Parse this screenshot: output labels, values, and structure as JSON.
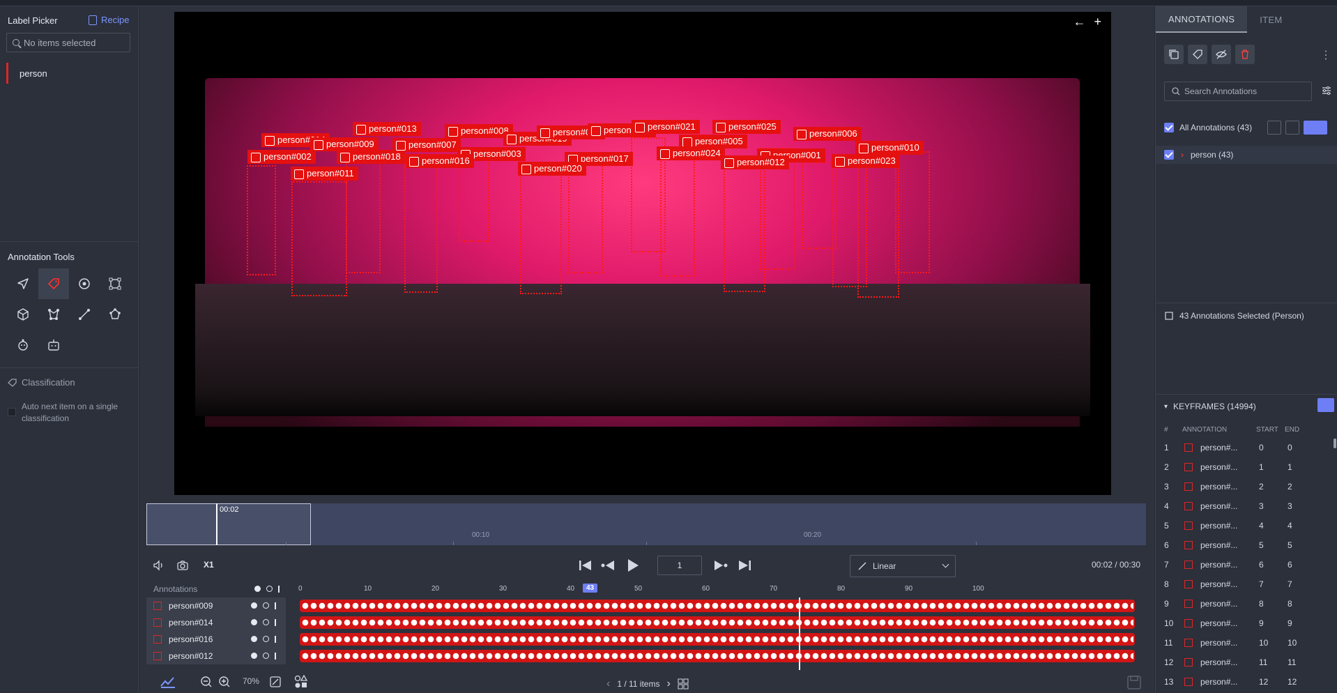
{
  "left_panel": {
    "title": "Label Picker",
    "recipe": "Recipe",
    "search_placeholder": "No items selected",
    "labels": [
      "person"
    ],
    "tools_title": "Annotation Tools",
    "classification": "Classification",
    "auto_next": "Auto next item on a single classification"
  },
  "video": {
    "annotations": [
      {
        "label": "person#014"
      },
      {
        "label": "person#009"
      },
      {
        "label": "person#013"
      },
      {
        "label": "person#008"
      },
      {
        "label": "person#019"
      },
      {
        "label": "person#022"
      },
      {
        "label": "person#004"
      },
      {
        "label": "person#021"
      },
      {
        "label": "person#025"
      },
      {
        "label": "person#006"
      },
      {
        "label": "person#002"
      },
      {
        "label": "person#018"
      },
      {
        "label": "person#007"
      },
      {
        "label": "person#003"
      },
      {
        "label": "person#016"
      },
      {
        "label": "person#017"
      },
      {
        "label": "person#005"
      },
      {
        "label": "person#024"
      },
      {
        "label": "person#001"
      },
      {
        "label": "person#010"
      },
      {
        "label": "person#011"
      },
      {
        "label": "person#020"
      },
      {
        "label": "person#012"
      },
      {
        "label": "person#023"
      }
    ]
  },
  "timeline": {
    "current": "00:02",
    "marks": [
      "00:10",
      "00:20"
    ]
  },
  "controls": {
    "speed": "X1",
    "frame": "1",
    "interpolation": "Linear",
    "time": "00:02 / 00:30"
  },
  "annotations_track": {
    "title": "Annotations",
    "ruler": [
      "0",
      "10",
      "20",
      "30",
      "40",
      "50",
      "60",
      "70",
      "80",
      "90",
      "100"
    ],
    "current_frame": "43",
    "rows": [
      "person#009",
      "person#014",
      "person#016",
      "person#012"
    ]
  },
  "bottom": {
    "zoom": "70%",
    "pager": "1 / 11 items"
  },
  "right_panel": {
    "tabs": [
      "ANNOTATIONS",
      "ITEM"
    ],
    "search_placeholder": "Search Annotations",
    "all_annotations": "All Annotations (43)",
    "group": "person (43)",
    "selected_info": "43 Annotations Selected (Person)",
    "keyframes_title": "KEYFRAMES (14994)",
    "kf_columns": [
      "#",
      "ANNOTATION",
      "START",
      "END"
    ],
    "keyframes": [
      {
        "n": "1",
        "name": "person#...",
        "start": "0",
        "end": "0"
      },
      {
        "n": "2",
        "name": "person#...",
        "start": "1",
        "end": "1"
      },
      {
        "n": "3",
        "name": "person#...",
        "start": "2",
        "end": "2"
      },
      {
        "n": "4",
        "name": "person#...",
        "start": "3",
        "end": "3"
      },
      {
        "n": "5",
        "name": "person#...",
        "start": "4",
        "end": "4"
      },
      {
        "n": "6",
        "name": "person#...",
        "start": "5",
        "end": "5"
      },
      {
        "n": "7",
        "name": "person#...",
        "start": "6",
        "end": "6"
      },
      {
        "n": "8",
        "name": "person#...",
        "start": "7",
        "end": "7"
      },
      {
        "n": "9",
        "name": "person#...",
        "start": "8",
        "end": "8"
      },
      {
        "n": "10",
        "name": "person#...",
        "start": "9",
        "end": "9"
      },
      {
        "n": "11",
        "name": "person#...",
        "start": "10",
        "end": "10"
      },
      {
        "n": "12",
        "name": "person#...",
        "start": "11",
        "end": "11"
      },
      {
        "n": "13",
        "name": "person#...",
        "start": "12",
        "end": "12"
      }
    ]
  },
  "colors": {
    "accent": "#6e7ef5",
    "annotation_red": "#e51010"
  }
}
